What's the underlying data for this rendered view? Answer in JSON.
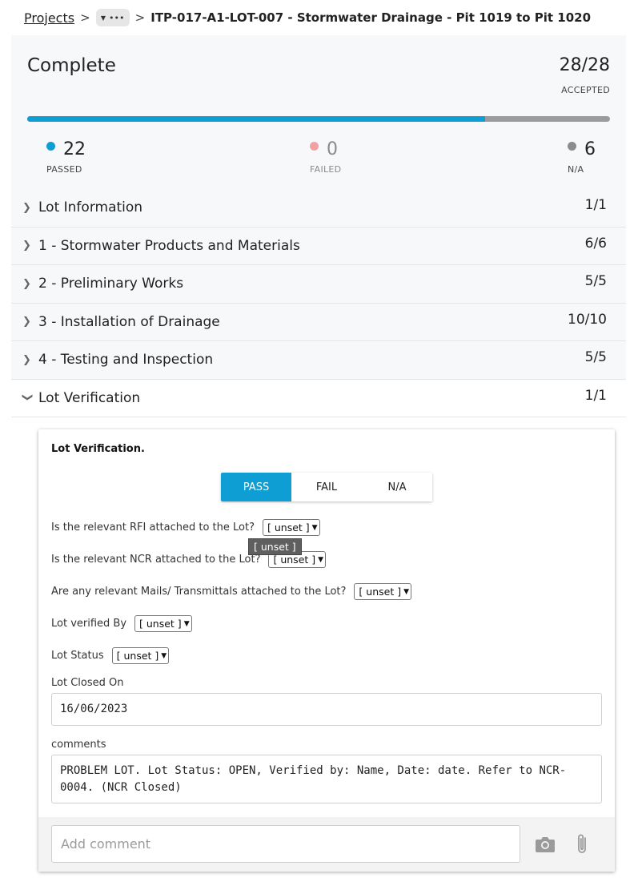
{
  "breadcrumb": {
    "root": "Projects",
    "separator": ">",
    "more": "•••",
    "current": "ITP-017-A1-LOT-007 - Stormwater Drainage - Pit 1019 to Pit 1020"
  },
  "summary": {
    "status": "Complete",
    "count": "28/28",
    "count_label": "ACCEPTED",
    "progress_fraction": 0.786,
    "passed": {
      "value": "22",
      "label": "PASSED",
      "color": "#0e9ed4"
    },
    "failed": {
      "value": "0",
      "label": "FAILED",
      "color": "#f4a1a5"
    },
    "na": {
      "value": "6",
      "label": "N/A",
      "color": "#8c8c8c"
    },
    "colors": {
      "accent": "#0e9ed4",
      "track": "#9b9b9b"
    }
  },
  "sections": [
    {
      "label": "Lot Information",
      "count": "1/1",
      "expanded": false
    },
    {
      "label": "1 - Stormwater Products and Materials",
      "count": "6/6",
      "expanded": false
    },
    {
      "label": "2 - Preliminary Works",
      "count": "5/5",
      "expanded": false
    },
    {
      "label": "3 - Installation of Drainage",
      "count": "10/10",
      "expanded": false
    },
    {
      "label": "4 - Testing and Inspection",
      "count": "5/5",
      "expanded": false
    },
    {
      "label": "Lot Verification",
      "count": "1/1",
      "expanded": true
    }
  ],
  "card": {
    "title": "Lot Verification.",
    "buttons": {
      "pass": "PASS",
      "fail": "FAIL",
      "na": "N/A",
      "selected": "PASS"
    },
    "questions": [
      {
        "label": "Is the relevant RFI attached to the Lot?",
        "value": "[ unset ]"
      },
      {
        "label": "Is the relevant NCR attached to the Lot?",
        "value": "[ unset ]"
      },
      {
        "label": "Are any relevant Mails/ Transmittals attached to the Lot?",
        "value": "[ unset ]"
      },
      {
        "label": "Lot verified By",
        "value": "[ unset ]"
      },
      {
        "label": "Lot Status",
        "value": "[ unset ]"
      }
    ],
    "tooltip": "[ unset ]",
    "closed_on": {
      "label": "Lot Closed On",
      "value": "16/06/2023"
    },
    "comments": {
      "label": "comments",
      "value": "PROBLEM LOT. Lot Status: OPEN, Verified by: Name, Date: date. Refer to NCR-0004. (NCR Closed)"
    },
    "comment_bar": {
      "placeholder": "Add comment",
      "camera_icon": "camera-icon",
      "attach_icon": "paperclip-icon"
    }
  }
}
